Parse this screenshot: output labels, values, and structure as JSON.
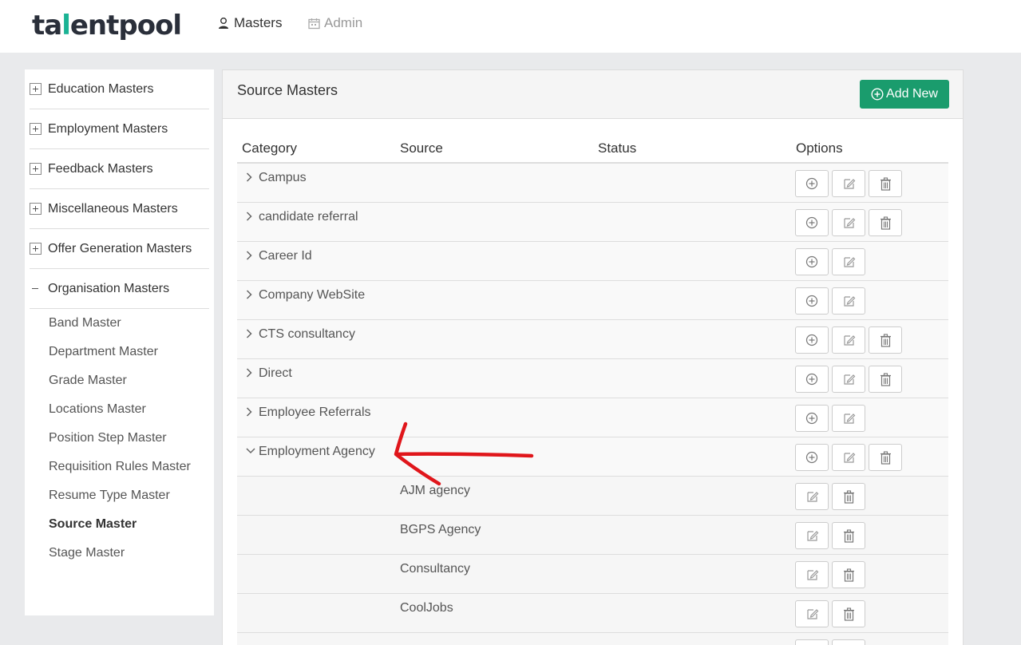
{
  "topbar": {
    "logo_left": "ta",
    "logo_accent": "l",
    "logo_right": "entpool",
    "nav": [
      {
        "label": "Masters",
        "icon": "user-icon"
      },
      {
        "label": "Admin",
        "icon": "calendar-icon"
      }
    ]
  },
  "sidebar": {
    "groups": [
      {
        "label": "Education Masters",
        "expanded": false
      },
      {
        "label": "Employment Masters",
        "expanded": false
      },
      {
        "label": "Feedback Masters",
        "expanded": false
      },
      {
        "label": "Miscellaneous Masters",
        "expanded": false
      },
      {
        "label": "Offer Generation Masters",
        "expanded": false
      },
      {
        "label": "Organisation Masters",
        "expanded": true
      }
    ],
    "items": [
      "Band Master",
      "Department Master",
      "Grade Master",
      "Locations Master",
      "Position Step Master",
      "Requisition Rules Master",
      "Resume Type Master",
      "Source Master",
      "Stage Master"
    ],
    "active_item": "Source Master"
  },
  "panel": {
    "title": "Source Masters",
    "add_label": "Add New",
    "columns": [
      "Category",
      "Source",
      "Status",
      "Options"
    ],
    "rows": [
      {
        "category": "Campus",
        "source": "",
        "expanded": false,
        "add": true,
        "edit": true,
        "delete": true
      },
      {
        "category": "candidate referral",
        "source": "",
        "expanded": false,
        "add": true,
        "edit": true,
        "delete": true
      },
      {
        "category": "Career Id",
        "source": "",
        "expanded": false,
        "add": true,
        "edit": true,
        "delete": false
      },
      {
        "category": "Company WebSite",
        "source": "",
        "expanded": false,
        "add": true,
        "edit": true,
        "delete": false
      },
      {
        "category": "CTS consultancy",
        "source": "",
        "expanded": false,
        "add": true,
        "edit": true,
        "delete": true
      },
      {
        "category": "Direct",
        "source": "",
        "expanded": false,
        "add": true,
        "edit": true,
        "delete": true
      },
      {
        "category": "Employee Referrals",
        "source": "",
        "expanded": false,
        "add": true,
        "edit": true,
        "delete": false
      },
      {
        "category": "Employment Agency",
        "source": "",
        "expanded": true,
        "add": true,
        "edit": true,
        "delete": true
      },
      {
        "category": "",
        "source": "AJM agency",
        "child": true,
        "add": false,
        "edit": true,
        "delete": true
      },
      {
        "category": "",
        "source": "BGPS Agency",
        "child": true,
        "add": false,
        "edit": true,
        "delete": true
      },
      {
        "category": "",
        "source": "Consultancy",
        "child": true,
        "add": false,
        "edit": true,
        "delete": true
      },
      {
        "category": "",
        "source": "CoolJobs",
        "child": true,
        "add": false,
        "edit": true,
        "delete": true
      },
      {
        "category": "",
        "source": "",
        "child": true,
        "add": false,
        "edit": true,
        "delete": true
      }
    ]
  },
  "colors": {
    "accent": "#1ab394",
    "add_button": "#1a9c6d",
    "annotation": "#e0161b"
  }
}
